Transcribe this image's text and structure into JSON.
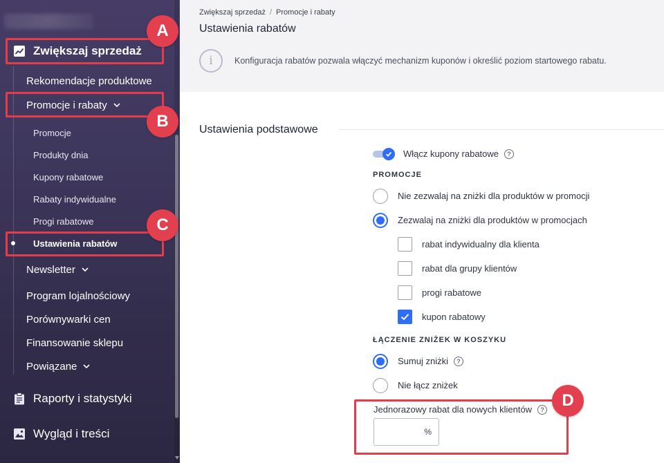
{
  "sidebar": {
    "section_main": "Zwiększaj sprzedaż",
    "items": [
      {
        "label": "Rekomendacje produktowe"
      },
      {
        "label": "Promocje i rabaty"
      },
      {
        "label": "Newsletter"
      },
      {
        "label": "Program lojalnościowy"
      },
      {
        "label": "Porównywarki cen"
      },
      {
        "label": "Finansowanie sklepu"
      },
      {
        "label": "Powiązane"
      }
    ],
    "subitems": [
      {
        "label": "Promocje"
      },
      {
        "label": "Produkty dnia"
      },
      {
        "label": "Kupony rabatowe"
      },
      {
        "label": "Rabaty indywidualne"
      },
      {
        "label": "Progi rabatowe"
      },
      {
        "label": "Ustawienia rabatów"
      }
    ],
    "bottom": [
      {
        "label": "Raporty i statystyki"
      },
      {
        "label": "Wygląd i treści"
      }
    ]
  },
  "breadcrumb": {
    "root": "Zwiększaj sprzedaż",
    "separator": "/",
    "current": "Promocje i rabaty"
  },
  "page_title": "Ustawienia rabatów",
  "info_text": "Konfiguracja rabatów pozwala włączyć mechanizm kuponów i określić poziom startowego rabatu.",
  "section_title": "Ustawienia podstawowe",
  "toggle": {
    "label": "Włącz kupony rabatowe",
    "on": true
  },
  "promocje": {
    "heading": "PROMOCJE",
    "options": [
      {
        "label": "Nie zezwalaj na zniżki dla produktów w promocji",
        "checked": false
      },
      {
        "label": "Zezwalaj na zniżki dla produktów w promocjach",
        "checked": true
      }
    ],
    "checkboxes": [
      {
        "label": "rabat indywidualny dla klienta",
        "checked": false
      },
      {
        "label": "rabat dla grupy klientów",
        "checked": false
      },
      {
        "label": "progi rabatowe",
        "checked": false
      },
      {
        "label": "kupon rabatowy",
        "checked": true
      }
    ]
  },
  "laczenie": {
    "heading": "ŁĄCZENIE ZNIŻEK W KOSZYKU",
    "options": [
      {
        "label": "Sumuj zniżki",
        "checked": true
      },
      {
        "label": "Nie łącz zniżek",
        "checked": false
      }
    ]
  },
  "onetime": {
    "label": "Jednorazowy rabat dla nowych klientów",
    "value": "",
    "unit": "%"
  },
  "annotations": [
    "A",
    "B",
    "C",
    "D"
  ],
  "colors": {
    "accent": "#2f6df6",
    "annotation": "#e2404e",
    "sidebar": "#3e375c"
  }
}
